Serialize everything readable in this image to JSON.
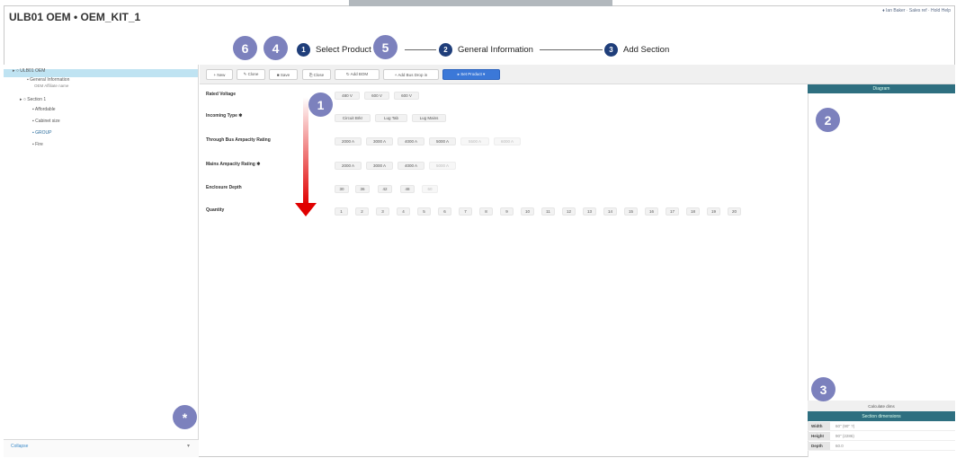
{
  "window": {
    "title": "ULB01 OEM • OEM_KIT_1",
    "user_links": "♦ Ian Baker · Sales ref · Hold Help"
  },
  "stepper": {
    "steps": [
      {
        "num": "1",
        "label": "Select Product"
      },
      {
        "num": "2",
        "label": "General Information"
      },
      {
        "num": "3",
        "label": "Add Section"
      }
    ]
  },
  "markers": {
    "m1": "1",
    "m2": "2",
    "m3": "3",
    "m4": "4",
    "m5": "5",
    "m6": "6",
    "star": "*"
  },
  "sidebar": {
    "items": [
      {
        "label": "▸ ○ ULB01 OEM"
      },
      {
        "label": "▪ General Information",
        "sub": "OEM Affiliate name"
      },
      {
        "label": "▸ ○ Section 1"
      },
      {
        "label": "▪ Affordable"
      },
      {
        "label": "▪ Cabinet size"
      },
      {
        "label": "▪ GROUP"
      },
      {
        "label": "▪ Fire"
      }
    ],
    "footer_select": "Collapse"
  },
  "toolbar": {
    "buttons": [
      {
        "label": "+ New"
      },
      {
        "label": "✎ Clone"
      },
      {
        "label": "■ Save"
      },
      {
        "label": "⎘ Close"
      },
      {
        "label": "↻ Add BOM"
      },
      {
        "label": "+ Add Bus Drop in"
      },
      {
        "label": "▸ Set Product ▾"
      }
    ]
  },
  "form": {
    "rows": [
      {
        "label": "Rated Voltage",
        "options": [
          "480 V",
          "600 V",
          "600 V"
        ]
      },
      {
        "label": "Incoming Type ✱",
        "options": [
          "Circuit Brkr",
          "Lug Tab",
          "Lug Mains"
        ]
      },
      {
        "label": "Through Bus Ampacity Rating",
        "options": [
          "2000 A",
          "3000 A",
          "4000 A",
          "5000 A",
          "5500 A",
          "6000 A"
        ]
      },
      {
        "label": "Mains Ampacity Rating ✱",
        "options": [
          "2000 A",
          "3000 A",
          "4000 A",
          "5000 A"
        ]
      },
      {
        "label": "Enclosure Depth",
        "options": [
          "30",
          "36",
          "42",
          "48",
          "60"
        ]
      },
      {
        "label": "Quantity",
        "options": [
          "1",
          "2",
          "3",
          "4",
          "5",
          "6",
          "7",
          "8",
          "9",
          "10",
          "11",
          "12",
          "13",
          "14",
          "15",
          "16",
          "17",
          "18",
          "19",
          "20"
        ]
      }
    ]
  },
  "diagram": {
    "header": "Diagram"
  },
  "dimensions": {
    "calc_label": "Calculate dims",
    "header": "Section dimensions",
    "rows": [
      {
        "key": "Width",
        "value": "60\" (90\" ?)"
      },
      {
        "key": "Height",
        "value": "90\" (2286)"
      },
      {
        "key": "Depth",
        "value": "60.0"
      }
    ]
  },
  "colors": {
    "accent": "#3b78d8",
    "panel_header": "#2e6f80",
    "step_dot": "#1f3e7a",
    "marker": "#7c81bd",
    "arrow": "#e00000",
    "selected_row": "#bfe3f2"
  }
}
